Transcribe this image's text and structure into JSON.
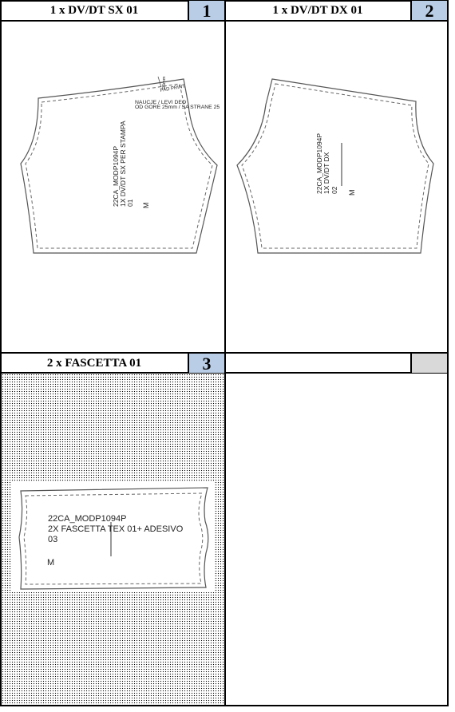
{
  "cells": [
    {
      "title": "1 x DV/DT SX 01",
      "number": "1"
    },
    {
      "title": "1 x DV/DT DX 01",
      "number": "2"
    },
    {
      "title": "2 x FASCETTA 01",
      "number": "3"
    },
    {
      "title": "",
      "number": ""
    }
  ],
  "piece1": {
    "line1": "22CA_MODP1094P",
    "line2": "1X DV/DT SX PER STAMPA",
    "line3": "01",
    "size": "M",
    "note1": "NAUCJE / LEVI DEO",
    "note2": "OD GORE 25mm / SA STRANE 25",
    "tag1": "PAD PRINT",
    "tag2": "25mm"
  },
  "piece2": {
    "line1": "22CA_MODP1094P",
    "line2": "1X DV/DT DX",
    "line3": "02",
    "size": "M"
  },
  "piece3": {
    "line1": "22CA_MODP1094P",
    "line2": "2X FASCETTA TEX 01+ ADESIVO",
    "line3": "03",
    "size": "M"
  }
}
